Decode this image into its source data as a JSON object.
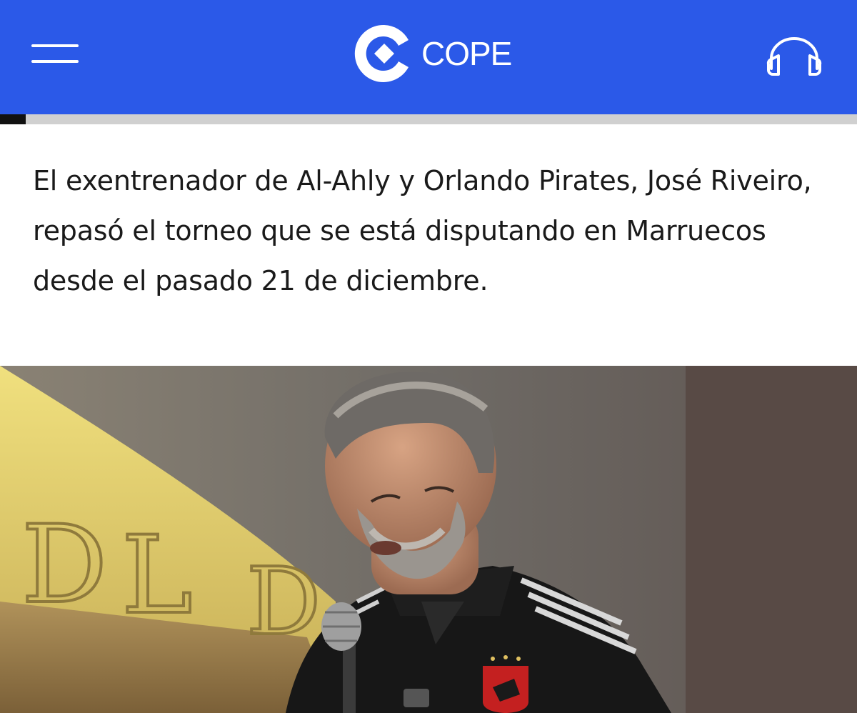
{
  "header": {
    "logo_text": "COPE",
    "menu_icon": "hamburger-menu-icon",
    "audio_icon": "headphones-icon",
    "brand_color": "#2b59e8"
  },
  "reading_progress": 0.03,
  "article": {
    "lead": "El exentrenador de Al-Ahly y Orlando Pirates, José Riveiro, repasó el torneo que se está disputando en Marruecos desde el pasado 21 de diciembre."
  }
}
